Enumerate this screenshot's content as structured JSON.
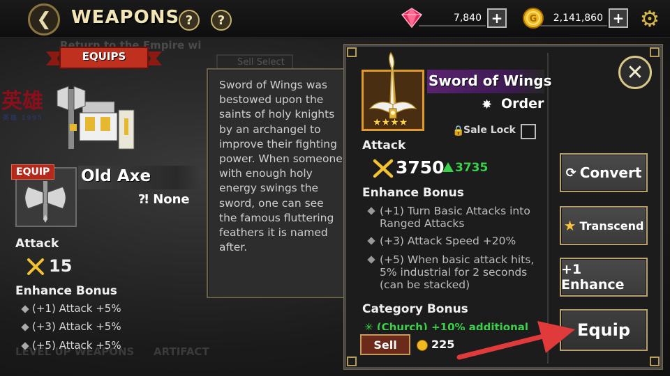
{
  "header": {
    "title": "WEAPONS",
    "help_1": "?",
    "help_2": "?",
    "gems": "7,840",
    "gold": "2,141,860",
    "plus": "+"
  },
  "background": {
    "return_text": "Return to the Empire wi",
    "sell_select": "Sell Select",
    "level_up": "LEVEL UP WEAPONS",
    "artifacts": "ARTIFACT",
    "kanji": "英雄",
    "kanji_sub": "英雄 1995"
  },
  "left": {
    "equips_label": "EQUIPS",
    "equip_badge": "EQUIP",
    "old_name": "Old Axe",
    "old_type": "None",
    "attack_label": "Attack",
    "attack_value": "15",
    "enhance_label": "Enhance Bonus",
    "enhance_items": [
      "(+1) Attack +5%",
      "(+3) Attack +5%",
      "(+5) Attack +5%"
    ]
  },
  "description": "Sword of Wings was bestowed upon the saints of holy knights by an archangel to improve their fighting power. When someone with enough holy energy swings the sword, one can see the famous fluttering feathers it is named after.",
  "detail": {
    "name": "Sword of Wings",
    "stars": "★★★★",
    "type": "Order",
    "sale_lock": "Sale Lock",
    "attack_label": "Attack",
    "attack_value": "3750",
    "attack_diff": "3735",
    "enhance_label": "Enhance Bonus",
    "enhance_items": [
      "(+1) Turn Basic Attacks into Ranged Attacks",
      "(+3) Attack Speed +20%",
      "(+5) When basic attack hits, 5% industrial for 2 seconds (can be stacked)"
    ],
    "category_label": "Category Bonus",
    "category_item": "(Church) +10% additional",
    "sell_label": "Sell",
    "sell_price": "225",
    "close": "✕"
  },
  "actions": {
    "convert": "Convert",
    "transcend": "Transcend",
    "enhance": "+1 Enhance",
    "equip": "Equip"
  },
  "colors": {
    "accent_gold": "#d8c88a",
    "positive_green": "#3ad04a",
    "name_purple": "#5a2470",
    "arrow_red": "#e03a3a"
  }
}
